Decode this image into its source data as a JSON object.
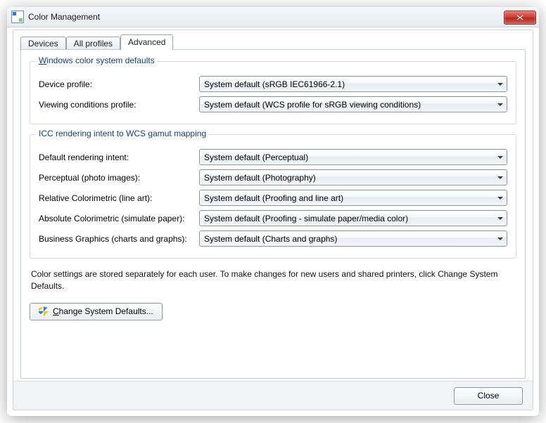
{
  "window": {
    "title": "Color Management"
  },
  "tabs": {
    "devices": "Devices",
    "all_profiles": "All profiles",
    "advanced": "Advanced"
  },
  "group1": {
    "legend_pre": "W",
    "legend_post": "indows color system defaults",
    "device_profile_label": "Device profile:",
    "device_profile_value": "System default (sRGB IEC61966-2.1)",
    "viewing_label": "Viewing conditions profile:",
    "viewing_value": "System default (WCS profile for sRGB viewing conditions)"
  },
  "group2": {
    "legend": "ICC  rendering intent to WCS gamut mapping",
    "default_intent_label": "Default rendering intent:",
    "default_intent_value": "System default (Perceptual)",
    "perceptual_label": "Perceptual (photo images):",
    "perceptual_value": "System default (Photography)",
    "relative_label": "Relative Colorimetric (line art):",
    "relative_value": "System default (Proofing and line art)",
    "absolute_label": "Absolute Colorimetric (simulate paper):",
    "absolute_value": "System default (Proofing - simulate paper/media color)",
    "business_label": "Business Graphics (charts and graphs):",
    "business_value": "System default (Charts and graphs)"
  },
  "note": "Color settings are stored separately for each user. To make changes for new users and shared printers, click Change System Defaults.",
  "change_defaults_pre": "C",
  "change_defaults_post": "hange System Defaults...",
  "close": "Close"
}
